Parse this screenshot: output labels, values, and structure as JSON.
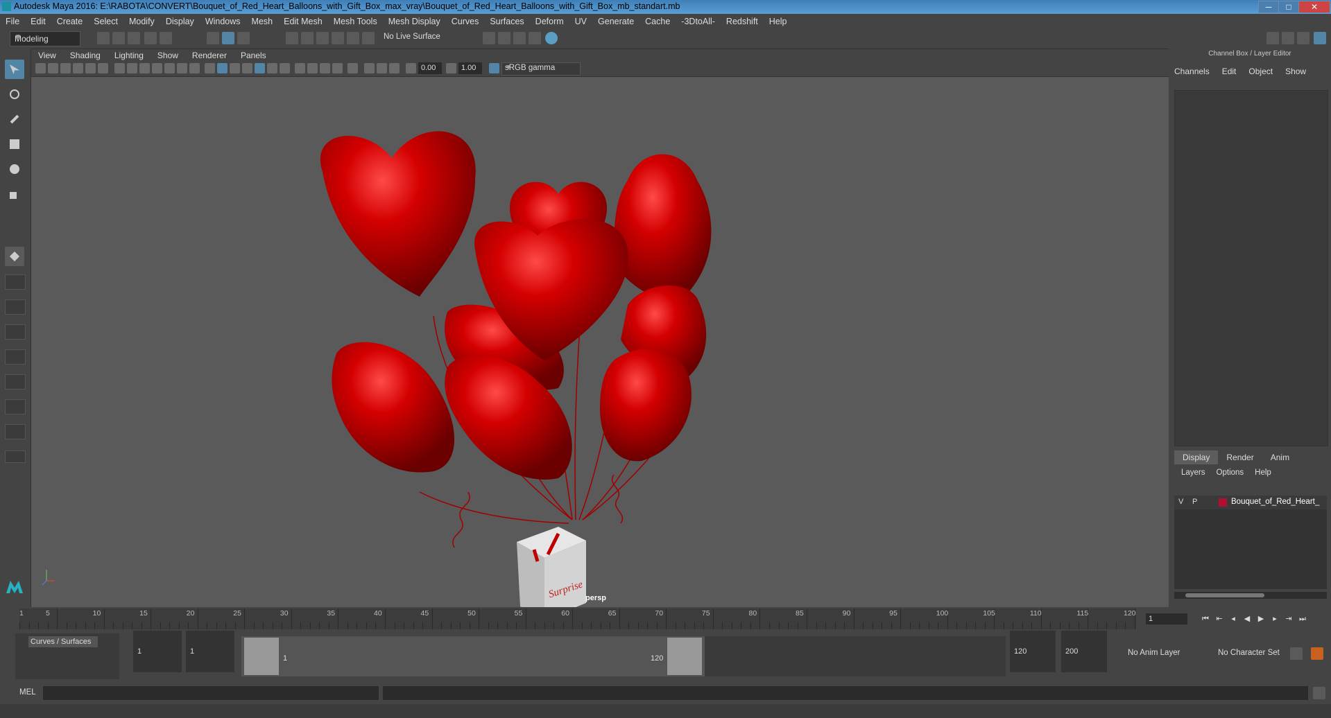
{
  "window": {
    "title": "Autodesk Maya 2016: E:\\RABOTA\\CONVERT\\Bouquet_of_Red_Heart_Balloons_with_Gift_Box_max_vray\\Bouquet_of_Red_Heart_Balloons_with_Gift_Box_mb_standart.mb",
    "minimize": "─",
    "maximize": "□",
    "close": "✕"
  },
  "menubar": [
    "File",
    "Edit",
    "Create",
    "Select",
    "Modify",
    "Display",
    "Windows",
    "Mesh",
    "Edit Mesh",
    "Mesh Tools",
    "Mesh Display",
    "Curves",
    "Surfaces",
    "Deform",
    "UV",
    "Generate",
    "Cache",
    "-3DtoAll-",
    "Redshift",
    "Help"
  ],
  "toolbar": {
    "mode": "Modeling",
    "live_surface": "No Live Surface"
  },
  "viewport": {
    "menu": [
      "View",
      "Shading",
      "Lighting",
      "Show",
      "Renderer",
      "Panels"
    ],
    "exposure": "0.00",
    "gamma": "1.00",
    "color_space": "sRGB gamma",
    "camera": "persp",
    "box_text": "Surprise",
    "colors": {
      "balloon": "#c00000",
      "box": "#d8d8d8",
      "ribbon": "#b80000"
    }
  },
  "right_panel": {
    "title": "Channel Box / Layer Editor",
    "tabs": [
      "Channels",
      "Edit",
      "Object",
      "Show"
    ],
    "layer_tabs": [
      "Display",
      "Render",
      "Anim"
    ],
    "layer_menu": [
      "Layers",
      "Options",
      "Help"
    ],
    "layer": {
      "v": "V",
      "p": "P",
      "name": "Bouquet_of_Red_Heart_",
      "color": "#b01030"
    }
  },
  "timeline": {
    "labels": [
      "5",
      "10",
      "15",
      "20",
      "25",
      "30",
      "35",
      "40",
      "45",
      "50",
      "55",
      "60",
      "65",
      "70",
      "75",
      "80",
      "85",
      "90",
      "95",
      "100",
      "105",
      "110",
      "115",
      "120"
    ],
    "start_label": "1",
    "current_frame": "1"
  },
  "range": {
    "shelf_tab": "Curves / Surfaces",
    "start": "1",
    "anim_start": "1",
    "range_start": "1",
    "range_end": "120",
    "anim_end": "120",
    "end": "200",
    "anim_layer": "No Anim Layer",
    "character_set": "No Character Set"
  },
  "command": {
    "label": "MEL"
  }
}
